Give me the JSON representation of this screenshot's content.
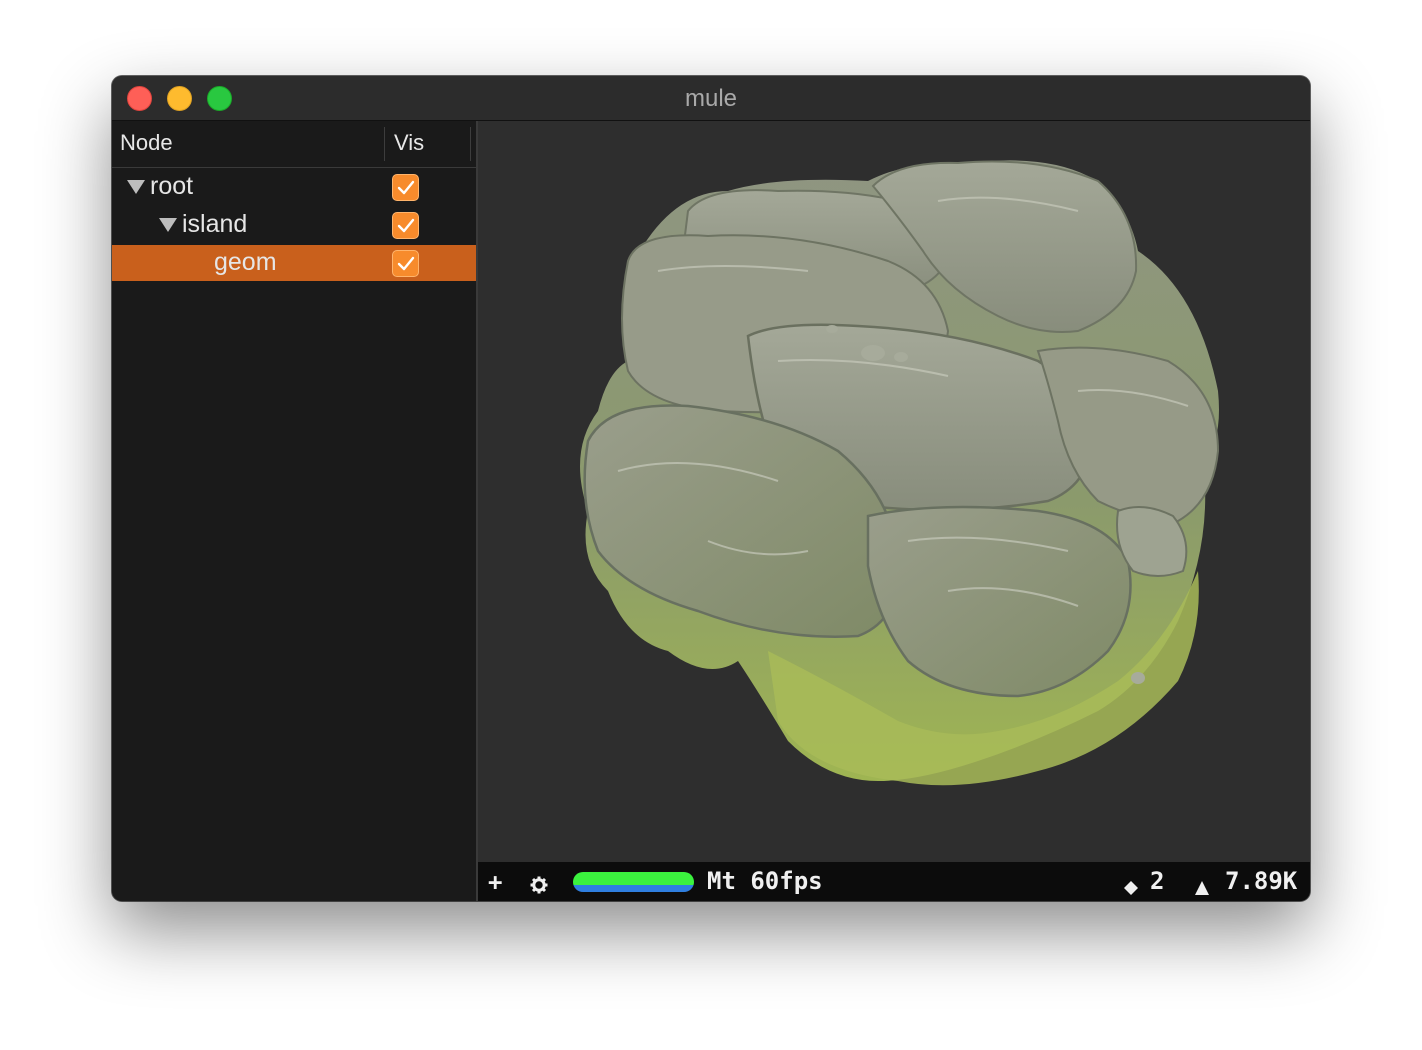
{
  "window": {
    "title": "mule"
  },
  "tree": {
    "columns": {
      "node": "Node",
      "vis": "Vis"
    },
    "items": [
      {
        "label": "root",
        "visible": true,
        "expanded": true,
        "selected": false
      },
      {
        "label": "island",
        "visible": true,
        "expanded": true,
        "selected": false
      },
      {
        "label": "geom",
        "visible": true,
        "selected": true
      }
    ]
  },
  "statusbar": {
    "add_icon": "plus-icon",
    "settings_icon": "gear-icon",
    "frame_meter_fraction": 1.0,
    "fps_text": "Mt 60fps",
    "node_count": "2",
    "triangle_count": "7.89K"
  },
  "colors": {
    "accent": "#c9601c",
    "checkbox": "#f78b2c",
    "meter_green": "#3bf23e",
    "meter_blue": "#2f7fe0",
    "viewport_bg": "#2e2e2e"
  }
}
